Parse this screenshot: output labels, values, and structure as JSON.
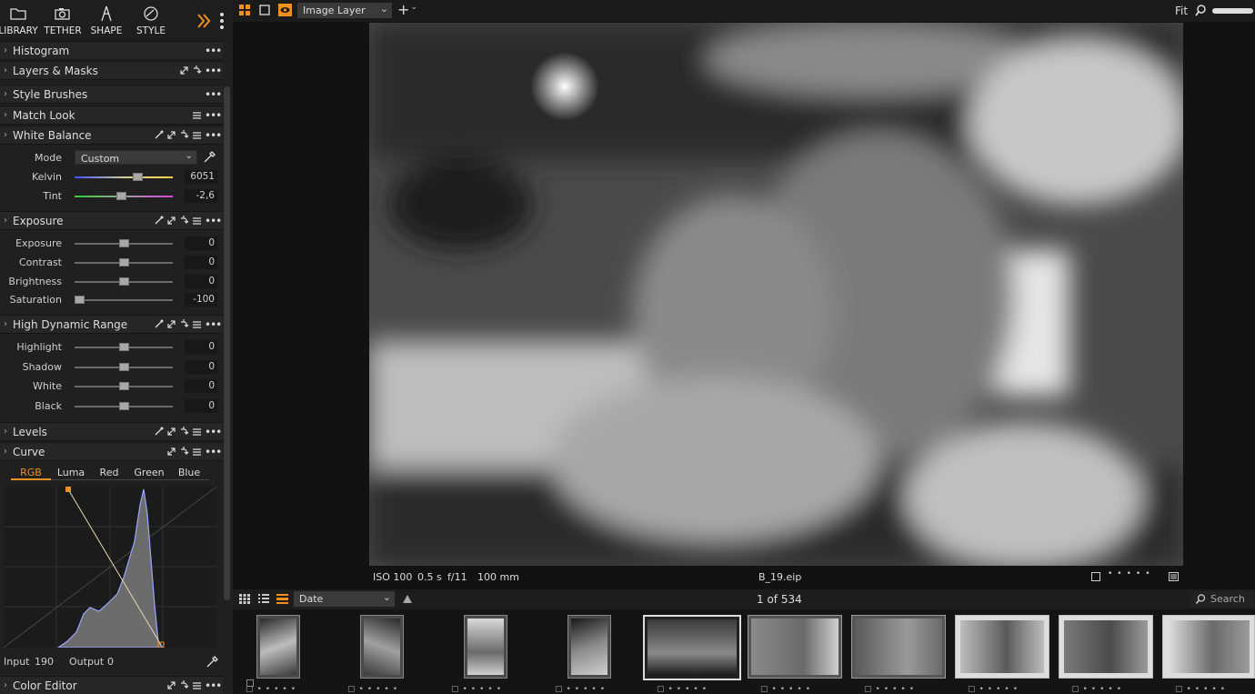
{
  "toolbar": {
    "items": [
      {
        "label": "LIBRARY",
        "icon": "folder-icon"
      },
      {
        "label": "TETHER",
        "icon": "camera-icon"
      },
      {
        "label": "SHAPE",
        "icon": "shape-icon"
      },
      {
        "label": "STYLE",
        "icon": "style-icon"
      }
    ]
  },
  "panels": {
    "histogram": "Histogram",
    "layers": "Layers & Masks",
    "style_brushes": "Style Brushes",
    "match_look": "Match Look",
    "white_balance": {
      "title": "White Balance",
      "mode_label": "Mode",
      "mode_value": "Custom",
      "kelvin_label": "Kelvin",
      "kelvin_value": "6051",
      "kelvin_level": 0.66,
      "tint_label": "Tint",
      "tint_value": "-2,6",
      "tint_level": 0.47
    },
    "exposure": {
      "title": "Exposure",
      "rows": [
        {
          "label": "Exposure",
          "value": "0",
          "level": 0.5
        },
        {
          "label": "Contrast",
          "value": "0",
          "level": 0.5
        },
        {
          "label": "Brightness",
          "value": "0",
          "level": 0.5
        },
        {
          "label": "Saturation",
          "value": "-100",
          "level": 0.0
        }
      ]
    },
    "hdr": {
      "title": "High Dynamic Range",
      "rows": [
        {
          "label": "Highlight",
          "value": "0",
          "level": 0.5
        },
        {
          "label": "Shadow",
          "value": "0",
          "level": 0.5
        },
        {
          "label": "White",
          "value": "0",
          "level": 0.5
        },
        {
          "label": "Black",
          "value": "0",
          "level": 0.5
        }
      ]
    },
    "levels": "Levels",
    "curve": {
      "title": "Curve",
      "tabs": [
        "RGB",
        "Luma",
        "Red",
        "Green",
        "Blue"
      ],
      "active_tab": "RGB",
      "input_label": "Input",
      "input_value": "190",
      "output_label": "Output",
      "output_value": "0"
    },
    "color_editor": "Color Editor"
  },
  "topbar": {
    "layer_select": "Image Layer",
    "zoom_label": "Fit"
  },
  "info": {
    "iso": "ISO 100",
    "shutter": "0.5 s",
    "aperture": "f/11",
    "focal": "100 mm",
    "filename": "B_19.eip"
  },
  "filmstrip": {
    "sort": "Date",
    "count": "1 of 534",
    "search_placeholder": "Search"
  },
  "colors": {
    "accent": "#f0901e",
    "panel": "#202020",
    "header": "#262626"
  }
}
